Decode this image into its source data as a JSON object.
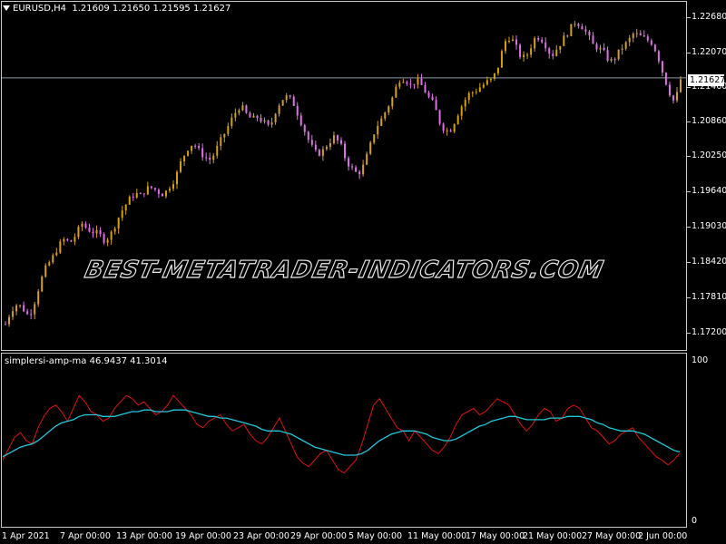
{
  "header": {
    "symbol": "EURUSD,H4",
    "ohlc": "1.21609 1.21650 1.21595 1.21627"
  },
  "indicator": {
    "label": "simplersi-amp-ma 46.9437 41.3014",
    "scale_top": "100",
    "scale_bottom": "0"
  },
  "price_axis": [
    "1.22680",
    "1.22070",
    "1.21460",
    "1.20860",
    "1.20250",
    "1.19640",
    "1.19030",
    "1.18420",
    "1.17810",
    "1.17200"
  ],
  "current_price": "1.21627",
  "date_axis": [
    "1 Apr 2021",
    "7 Apr 00:00",
    "13 Apr 00:00",
    "19 Apr 00:00",
    "23 Apr 00:00",
    "29 Apr 00:00",
    "5 May 00:00",
    "11 May 00:00",
    "17 May 00:00",
    "21 May 00:00",
    "27 May 00:00",
    "2 Jun 00:00"
  ],
  "watermark": "BEST-METATRADER-INDICATORS.COM",
  "colors": {
    "bull": "#d4a017",
    "bear": "#e070e8",
    "rsi": "#e01010",
    "ma": "#20c8d8",
    "grid": "#c8c8c8"
  },
  "chart_data": {
    "type": "line",
    "price_ylim": [
      1.17,
      1.229
    ],
    "close_path": [
      1.1735,
      1.176,
      1.177,
      1.1762,
      1.1748,
      1.1775,
      1.181,
      1.1835,
      1.185,
      1.187,
      1.1882,
      1.1876,
      1.189,
      1.191,
      1.19,
      1.1895,
      1.189,
      1.188,
      1.1892,
      1.1915,
      1.1935,
      1.195,
      1.1962,
      1.1958,
      1.197,
      1.1972,
      1.1965,
      1.196,
      1.1975,
      1.199,
      1.202,
      1.204,
      1.205,
      1.2035,
      1.2025,
      1.202,
      1.204,
      1.206,
      1.208,
      1.21,
      1.2115,
      1.21,
      1.209,
      1.2095,
      1.2085,
      1.2075,
      1.2105,
      1.2125,
      1.213,
      1.212,
      1.2095,
      1.207,
      1.2045,
      1.203,
      1.2035,
      1.205,
      1.206,
      1.2048,
      1.202,
      1.2005,
      1.1995,
      1.201,
      1.204,
      1.2075,
      1.209,
      1.211,
      1.213,
      1.216,
      1.2162,
      1.215,
      1.2158,
      1.2148,
      1.213,
      1.2115,
      1.2085,
      1.207,
      1.2075,
      1.21,
      1.212,
      1.2135,
      1.214,
      1.2148,
      1.2155,
      1.216,
      1.2185,
      1.2225,
      1.2235,
      1.2215,
      1.2195,
      1.2205,
      1.223,
      1.2235,
      1.222,
      1.22,
      1.2215,
      1.223,
      1.2245,
      1.226,
      1.2255,
      1.224,
      1.222,
      1.2215,
      1.2205,
      1.219,
      1.22,
      1.2215,
      1.2225,
      1.224,
      1.2235,
      1.223,
      1.2225,
      1.2205,
      1.217,
      1.214,
      1.2118,
      1.216
    ],
    "rsi_ylim": [
      0,
      100
    ],
    "rsi": [
      38,
      45,
      52,
      55,
      50,
      48,
      58,
      65,
      70,
      72,
      68,
      62,
      70,
      78,
      74,
      68,
      66,
      62,
      64,
      70,
      74,
      78,
      76,
      72,
      74,
      70,
      66,
      68,
      72,
      78,
      74,
      70,
      66,
      60,
      58,
      62,
      64,
      66,
      60,
      56,
      58,
      60,
      54,
      50,
      48,
      52,
      58,
      64,
      56,
      48,
      40,
      36,
      34,
      38,
      42,
      44,
      38,
      32,
      30,
      34,
      38,
      48,
      60,
      72,
      76,
      70,
      64,
      58,
      56,
      50,
      56,
      52,
      48,
      44,
      42,
      46,
      52,
      60,
      66,
      68,
      70,
      66,
      68,
      72,
      76,
      74,
      72,
      66,
      60,
      56,
      60,
      66,
      70,
      68,
      62,
      64,
      70,
      72,
      70,
      64,
      58,
      56,
      52,
      48,
      50,
      54,
      56,
      58,
      52,
      48,
      44,
      40,
      38,
      35,
      38,
      42
    ],
    "ma": [
      40,
      42,
      44,
      46,
      47,
      48,
      50,
      53,
      56,
      59,
      61,
      62,
      63,
      65,
      66,
      66,
      66,
      65,
      65,
      65,
      66,
      67,
      68,
      68,
      69,
      69,
      68,
      68,
      68,
      69,
      69,
      69,
      68,
      67,
      66,
      65,
      65,
      64,
      64,
      63,
      62,
      61,
      60,
      59,
      57,
      56,
      56,
      56,
      55,
      54,
      52,
      50,
      48,
      46,
      45,
      44,
      43,
      42,
      41,
      41,
      41,
      42,
      44,
      47,
      50,
      52,
      54,
      55,
      56,
      56,
      56,
      55,
      54,
      52,
      51,
      50,
      50,
      51,
      53,
      55,
      57,
      59,
      60,
      62,
      63,
      64,
      65,
      65,
      64,
      63,
      63,
      63,
      63,
      64,
      64,
      64,
      65,
      65,
      65,
      64,
      63,
      61,
      60,
      58,
      57,
      56,
      56,
      56,
      55,
      54,
      52,
      50,
      48,
      46,
      44,
      43
    ]
  }
}
